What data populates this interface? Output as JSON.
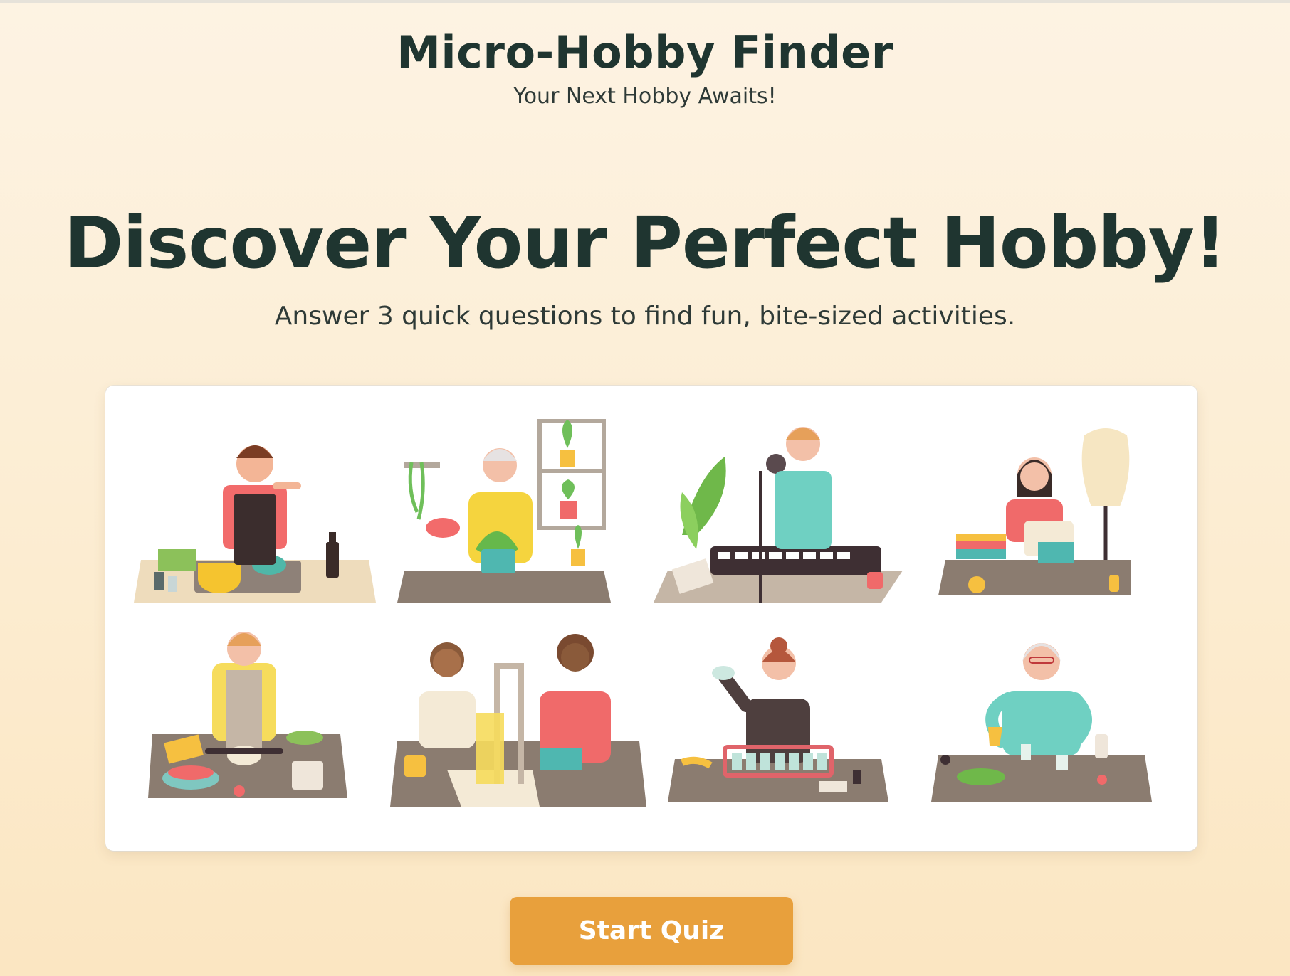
{
  "header": {
    "title": "Micro-Hobby Finder",
    "subtitle": "Your Next Hobby Awaits!"
  },
  "hero": {
    "title": "Discover Your Perfect Hobby!",
    "subtitle": "Answer 3 quick questions to find fun, bite-sized activities."
  },
  "illustrations": [
    {
      "icon": "cooking-illustration"
    },
    {
      "icon": "gardening-illustration"
    },
    {
      "icon": "music-keyboard-illustration"
    },
    {
      "icon": "sewing-illustration"
    },
    {
      "icon": "baking-illustration"
    },
    {
      "icon": "woodworking-illustration"
    },
    {
      "icon": "soap-making-illustration"
    },
    {
      "icon": "candle-making-illustration"
    }
  ],
  "actions": {
    "start_label": "Start Quiz"
  },
  "colors": {
    "accent": "#e8a03c",
    "heading": "#1f3530",
    "background": "#fdf3e3"
  }
}
